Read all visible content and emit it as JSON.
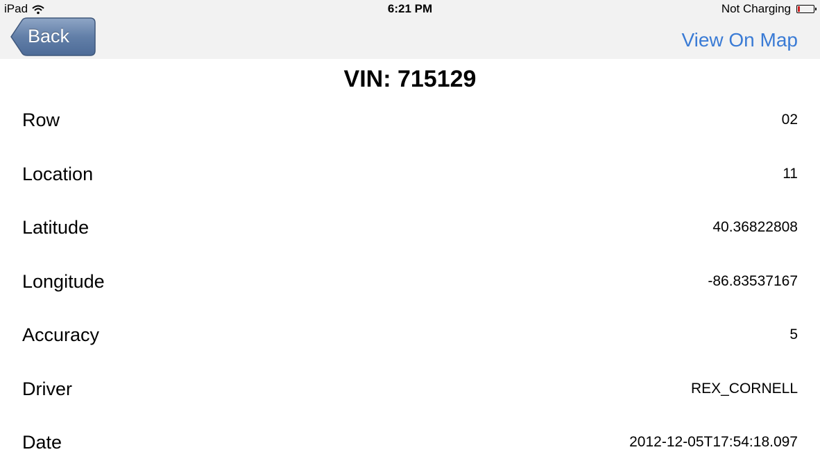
{
  "status_bar": {
    "device": "iPad",
    "time": "6:21 PM",
    "battery_text": "Not Charging",
    "wifi_icon": "wifi-icon",
    "battery_icon": "battery-icon"
  },
  "nav": {
    "back_label": "Back",
    "map_label": "View On Map"
  },
  "title": "VIN: 715129",
  "details": [
    {
      "label": "Row",
      "value": "02"
    },
    {
      "label": "Location",
      "value": "11"
    },
    {
      "label": "Latitude",
      "value": "40.36822808"
    },
    {
      "label": "Longitude",
      "value": "-86.83537167"
    },
    {
      "label": "Accuracy",
      "value": "5"
    },
    {
      "label": "Driver",
      "value": "REX_CORNELL"
    },
    {
      "label": "Date",
      "value": "2012-12-05T17:54:18.097"
    }
  ],
  "colors": {
    "nav_background": "#f2f2f2",
    "link": "#3a7bd5",
    "back_button": "#5a7aa6"
  }
}
